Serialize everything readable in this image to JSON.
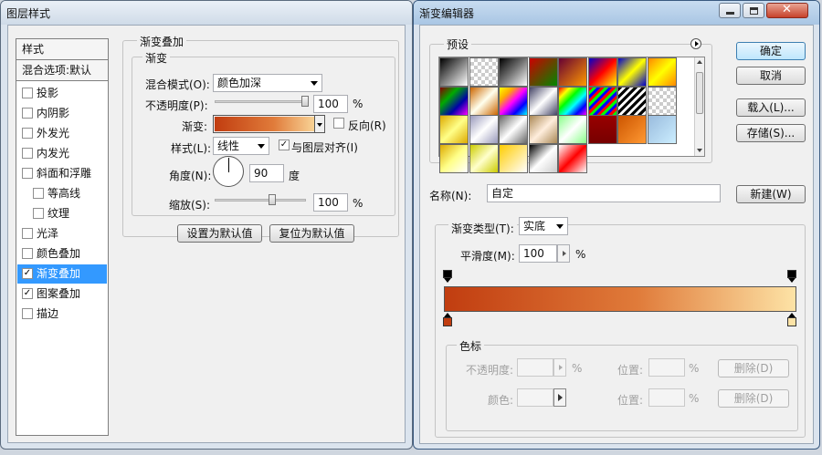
{
  "layer_style": {
    "title": "图层样式",
    "sidebar": {
      "header": "样式",
      "blend_default": "混合选项:默认",
      "items": [
        {
          "label": "投影",
          "checked": false
        },
        {
          "label": "内阴影",
          "checked": false
        },
        {
          "label": "外发光",
          "checked": false
        },
        {
          "label": "内发光",
          "checked": false
        },
        {
          "label": "斜面和浮雕",
          "checked": false
        },
        {
          "label": "等高线",
          "checked": false
        },
        {
          "label": "纹理",
          "checked": false
        },
        {
          "label": "光泽",
          "checked": false
        },
        {
          "label": "颜色叠加",
          "checked": false
        },
        {
          "label": "渐变叠加",
          "checked": true
        },
        {
          "label": "图案叠加",
          "checked": true
        },
        {
          "label": "描边",
          "checked": false
        }
      ]
    },
    "panel": {
      "group_title": "渐变叠加",
      "sub_group_title": "渐变",
      "blend_mode_label": "混合模式(O):",
      "blend_mode_value": "颜色加深",
      "opacity_label": "不透明度(P):",
      "opacity_value": "100",
      "opacity_unit": "%",
      "gradient_label": "渐变:",
      "reverse_label": "反向(R)",
      "style_label": "样式(L):",
      "style_value": "线性",
      "align_label": "与图层对齐(I)",
      "angle_label": "角度(N):",
      "angle_value": "90",
      "angle_unit": "度",
      "scale_label": "缩放(S):",
      "scale_value": "100",
      "scale_unit": "%",
      "set_default_button": "设置为默认值",
      "reset_default_button": "复位为默认值"
    }
  },
  "gradient_editor": {
    "title": "渐变编辑器",
    "presets_label": "预设",
    "ok_button": "确定",
    "cancel_button": "取消",
    "load_button": "载入(L)...",
    "save_button": "存储(S)...",
    "name_label": "名称(N):",
    "name_value": "自定",
    "new_button": "新建(W)",
    "gradient_type_label": "渐变类型(T):",
    "gradient_type_value": "实底",
    "smoothness_label": "平滑度(M):",
    "smoothness_value": "100",
    "smoothness_unit": "%",
    "stops_group": "色标",
    "stop_opacity_label": "不透明度:",
    "stop_opacity_unit": "%",
    "stop_location_label": "位置:",
    "stop_location_unit": "%",
    "delete_button": "删除(D)",
    "stop_color_label": "颜色:",
    "stop_location_label_2": "位置:",
    "stop_location_unit_2": "%",
    "delete_button_2": "删除(D)",
    "gradient_colors": {
      "start": "#c13d10",
      "mid": "#e07b3a",
      "end": "#fde3a6"
    }
  }
}
